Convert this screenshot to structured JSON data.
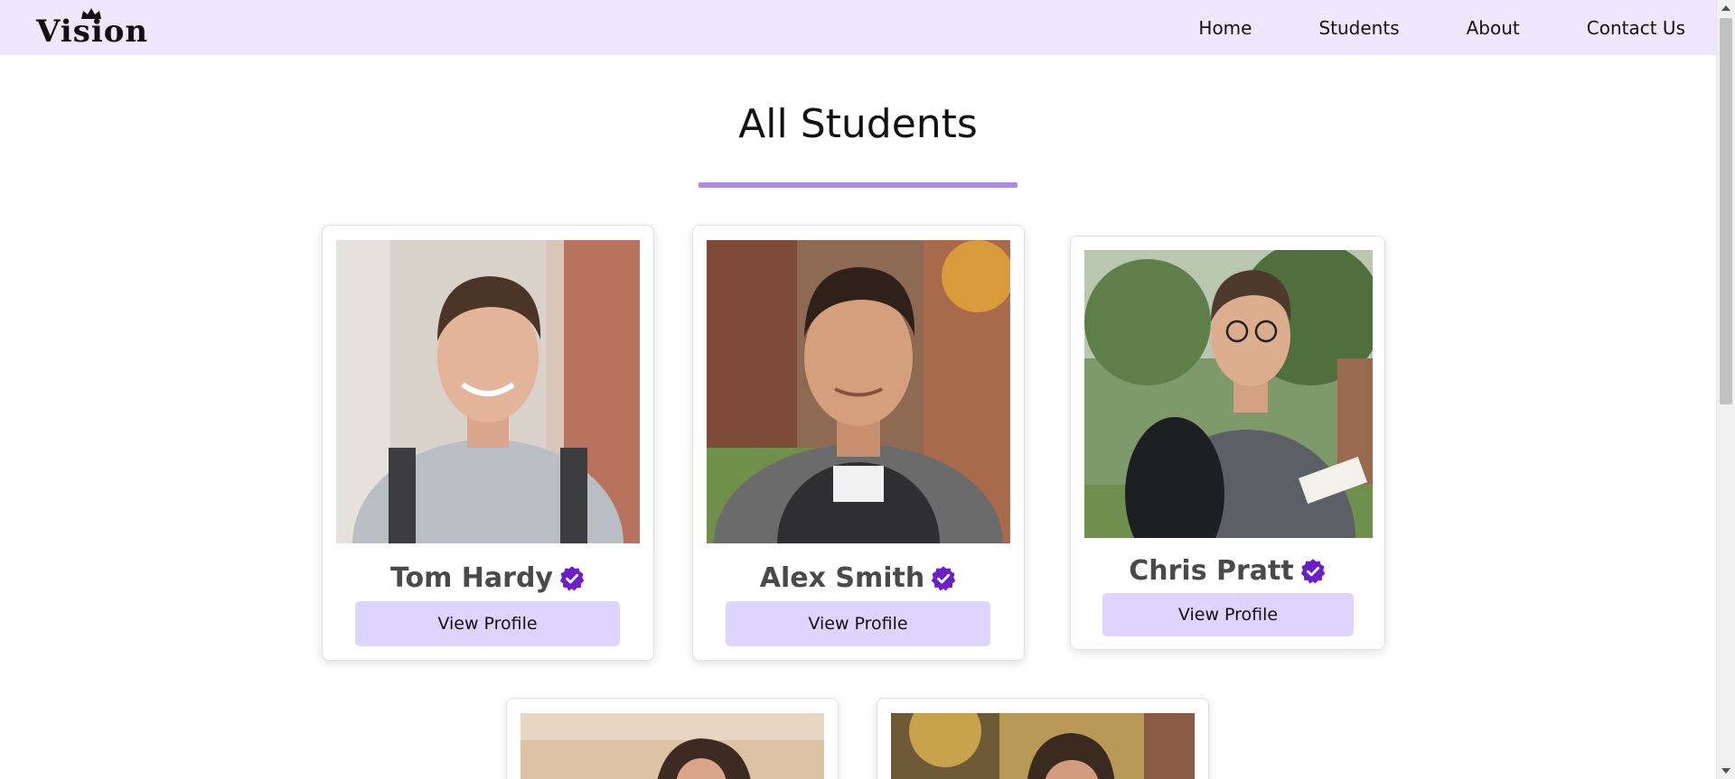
{
  "brand": {
    "logo_text": "Vision"
  },
  "nav": {
    "items": [
      {
        "label": "Home"
      },
      {
        "label": "Students"
      },
      {
        "label": "About"
      },
      {
        "label": "Contact Us"
      }
    ]
  },
  "page": {
    "title": "All Students"
  },
  "students": [
    {
      "name": "Tom Hardy",
      "button": "View Profile"
    },
    {
      "name": "Alex Smith",
      "button": "View Profile"
    },
    {
      "name": "Chris Pratt",
      "button": "View Profile"
    }
  ],
  "colors": {
    "nav_background": "#efe8fc",
    "accent_underline": "#ae8ae3",
    "button_background": "#ddd5fd",
    "verified_badge": "#6a1fc8"
  }
}
